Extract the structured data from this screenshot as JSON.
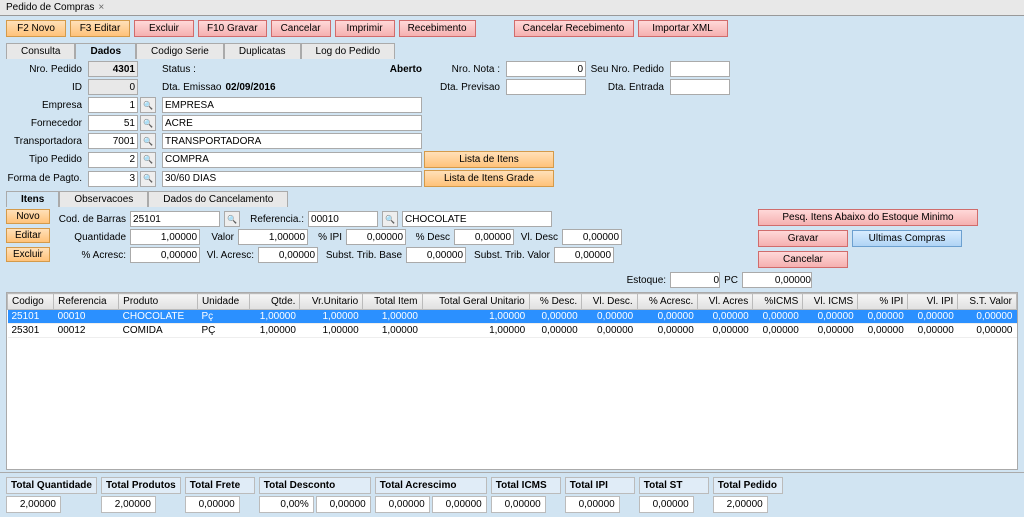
{
  "window": {
    "title": "Pedido de Compras"
  },
  "toolbar": {
    "novo": "F2 Novo",
    "editar": "F3 Editar",
    "excluir": "Excluir",
    "gravar": "F10 Gravar",
    "cancelar": "Cancelar",
    "imprimir": "Imprimir",
    "receb": "Recebimento",
    "canc_receb": "Cancelar Recebimento",
    "import_xml": "Importar XML"
  },
  "tabs_main": {
    "consulta": "Consulta",
    "dados": "Dados",
    "cod_serie": "Codigo Serie",
    "duplicatas": "Duplicatas",
    "log": "Log do Pedido"
  },
  "header": {
    "nro_pedido_lbl": "Nro. Pedido",
    "nro_pedido": "4301",
    "status_lbl": "Status :",
    "status": "Aberto",
    "nro_nota_lbl": "Nro. Nota :",
    "nro_nota": "0",
    "seu_nro_lbl": "Seu Nro. Pedido",
    "seu_nro": "",
    "id_lbl": "ID",
    "id": "0",
    "dta_emissao_lbl": "Dta. Emissao",
    "dta_emissao": "02/09/2016",
    "dta_prev_lbl": "Dta. Previsao",
    "dta_prev": "",
    "dta_ent_lbl": "Dta. Entrada",
    "dta_ent": "",
    "empresa_lbl": "Empresa",
    "empresa_cod": "1",
    "empresa_nome": "EMPRESA",
    "fornecedor_lbl": "Fornecedor",
    "fornecedor_cod": "51",
    "fornecedor_nome": "ACRE",
    "transp_lbl": "Transportadora",
    "transp_cod": "7001",
    "transp_nome": "TRANSPORTADORA",
    "tipo_lbl": "Tipo Pedido",
    "tipo_cod": "2",
    "tipo_nome": "COMPRA",
    "pagto_lbl": "Forma de Pagto.",
    "pagto_cod": "3",
    "pagto_nome": "30/60 DIAS",
    "lista_itens": "Lista de Itens",
    "lista_grade": "Lista de Itens Grade"
  },
  "tabs_item": {
    "itens": "Itens",
    "obs": "Observacoes",
    "cancel": "Dados do Cancelamento"
  },
  "item_btns": {
    "novo": "Novo",
    "editar": "Editar",
    "excluir": "Excluir"
  },
  "item": {
    "cod_barras_lbl": "Cod. de Barras",
    "cod_barras": "25101",
    "ref_lbl": "Referencia.:",
    "ref": "00010",
    "prod_nome": "CHOCOLATE",
    "qtd_lbl": "Quantidade",
    "qtd": "1,00000",
    "valor_lbl": "Valor",
    "valor": "1,00000",
    "ipi_lbl": "% IPI",
    "ipi": "0,00000",
    "desc_lbl": "% Desc",
    "desc": "0,00000",
    "vldesc_lbl": "Vl. Desc",
    "vldesc": "0,00000",
    "acresc_lbl": "% Acresc:",
    "acresc": "0,00000",
    "vlacresc_lbl": "Vl. Acresc:",
    "vlacresc": "0,00000",
    "stb_lbl": "Subst. Trib. Base",
    "stb": "0,00000",
    "stv_lbl": "Subst. Trib. Valor",
    "stv": "0,00000"
  },
  "side": {
    "pesq": "Pesq. Itens Abaixo do Estoque Minimo",
    "gravar": "Gravar",
    "ultimas": "Ultimas Compras",
    "cancelar": "Cancelar"
  },
  "estoque": {
    "lbl": "Estoque:",
    "qtd": "0",
    "un": "PC",
    "val": "0,00000"
  },
  "grid_headers": [
    "Codigo",
    "Referencia",
    "Produto",
    "Unidade",
    "Qtde.",
    "Vr.Unitario",
    "Total Item",
    "Total Geral Unitario",
    "% Desc.",
    "Vl. Desc.",
    "% Acresc.",
    "Vl. Acres",
    "%ICMS",
    "Vl. ICMS",
    "% IPI",
    "Vl. IPI",
    "S.T. Valor"
  ],
  "grid_rows": [
    {
      "selected": true,
      "cells": [
        "25101",
        "00010",
        "CHOCOLATE",
        "Pç",
        "1,00000",
        "1,00000",
        "1,00000",
        "1,00000",
        "0,00000",
        "0,00000",
        "0,00000",
        "0,00000",
        "0,00000",
        "0,00000",
        "0,00000",
        "0,00000",
        "0,00000"
      ]
    },
    {
      "selected": false,
      "cells": [
        "25301",
        "00012",
        "COMIDA",
        "PÇ",
        "1,00000",
        "1,00000",
        "1,00000",
        "1,00000",
        "0,00000",
        "0,00000",
        "0,00000",
        "0,00000",
        "0,00000",
        "0,00000",
        "0,00000",
        "0,00000",
        "0,00000"
      ]
    }
  ],
  "totals": {
    "labels": [
      "Total Quantidade",
      "Total Produtos",
      "Total Frete",
      "Total Desconto",
      "Total Acrescimo",
      "Total ICMS",
      "Total IPI",
      "Total ST",
      "Total Pedido"
    ],
    "values": [
      "2,00000",
      "2,00000",
      "0,00000",
      "0,00%",
      "0,00000",
      "0,00000",
      "0,00000",
      "0,00000",
      "0,00000",
      "0,00000",
      "2,00000"
    ]
  }
}
